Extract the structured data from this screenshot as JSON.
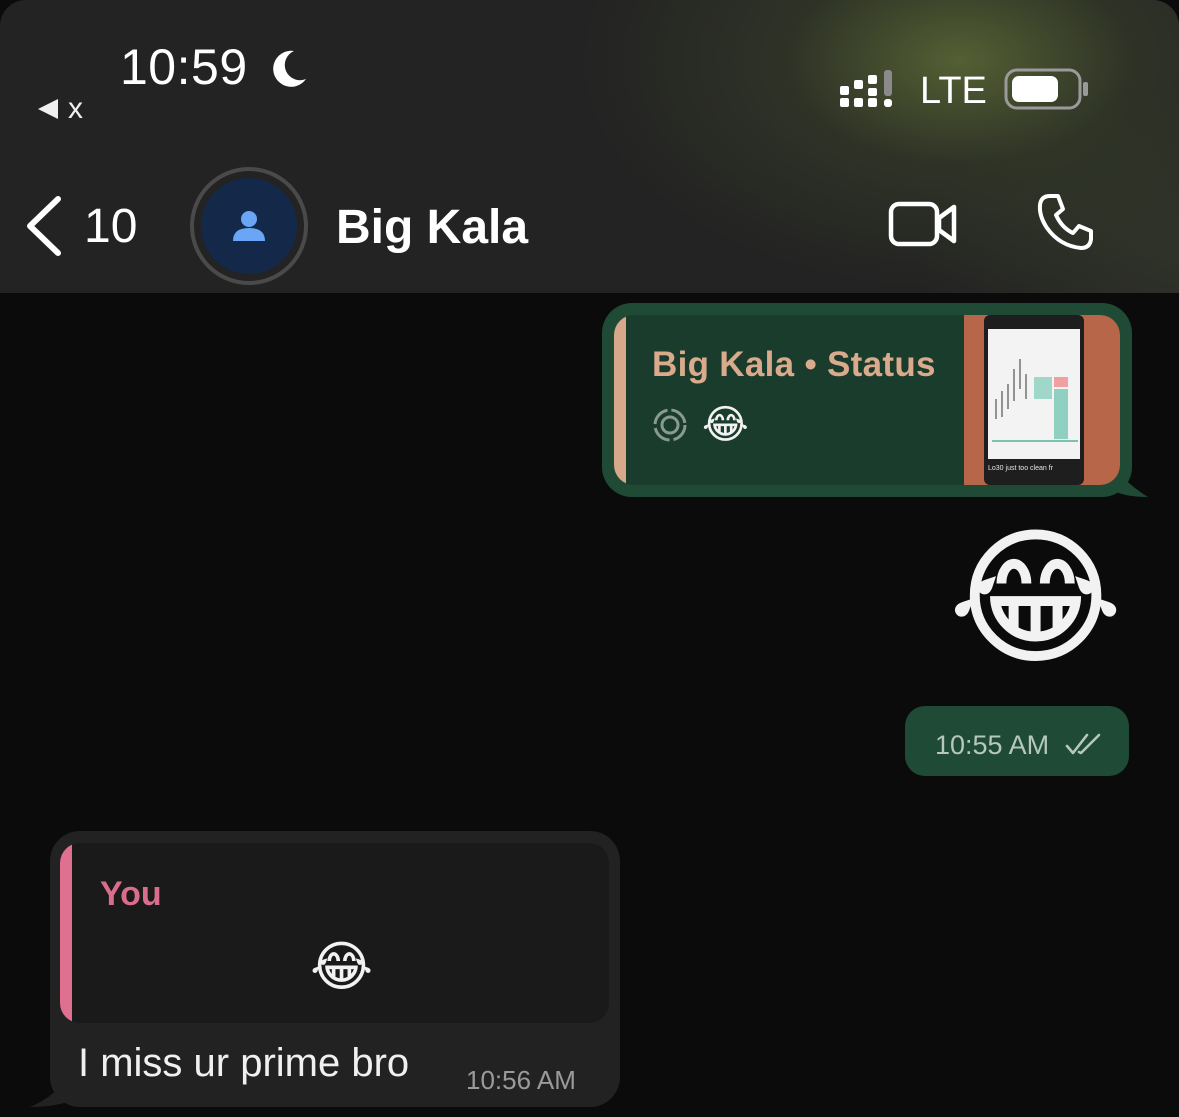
{
  "status_bar": {
    "time": "10:59",
    "back_app_label": "x",
    "network": "LTE",
    "icons": [
      "moon-icon",
      "signal-icon",
      "battery-icon"
    ]
  },
  "nav": {
    "back_count": "10",
    "contact_name": "Big Kala",
    "icons": [
      "chevron-left-icon",
      "person-icon",
      "video-camera-icon",
      "phone-icon"
    ]
  },
  "messages": [
    {
      "direction": "outgoing",
      "quoted": {
        "title": "Big Kala • Status",
        "emoji": "😂",
        "icon": "status-ring-icon"
      },
      "thumbnail_caption": "Lo30 just too clean fr"
    },
    {
      "direction": "outgoing",
      "emoji": "😂",
      "time": "10:55 AM",
      "status_icon": "double-check-icon"
    },
    {
      "direction": "incoming",
      "quoted": {
        "author": "You",
        "emoji": "😂"
      },
      "text": "I miss ur prime bro",
      "time": "10:56 AM"
    }
  ],
  "colors": {
    "outgoing_bubble": "#1f4a35",
    "incoming_bubble": "#222222",
    "status_quote_bar": "#d7a98a",
    "reply_quote_bar": "#e0708f"
  }
}
